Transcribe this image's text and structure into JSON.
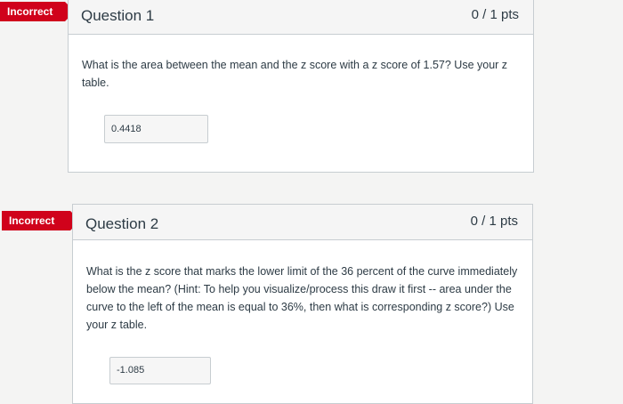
{
  "questions": [
    {
      "status_badge": "Incorrect",
      "title": "Question 1",
      "points": "0 / 1 pts",
      "text": "What is the area between the mean and the z score with a z score of 1.57? Use your z table.",
      "answer": "0.4418"
    },
    {
      "status_badge": "Incorrect",
      "title": "Question 2",
      "points": "0 / 1 pts",
      "text": "What is the z score that marks the lower limit of the 36 percent of the curve immediately below the mean? (Hint: To help you visualize/process this draw it first -- area under the curve to the left of the mean is equal to 36%, then what is corresponding z score?) Use your z table.",
      "answer": "-1.085"
    }
  ],
  "colors": {
    "incorrect_badge": "#d0021b",
    "card_border": "#c7cdd1",
    "header_bg": "#f5f5f5",
    "text": "#2d3b45"
  }
}
